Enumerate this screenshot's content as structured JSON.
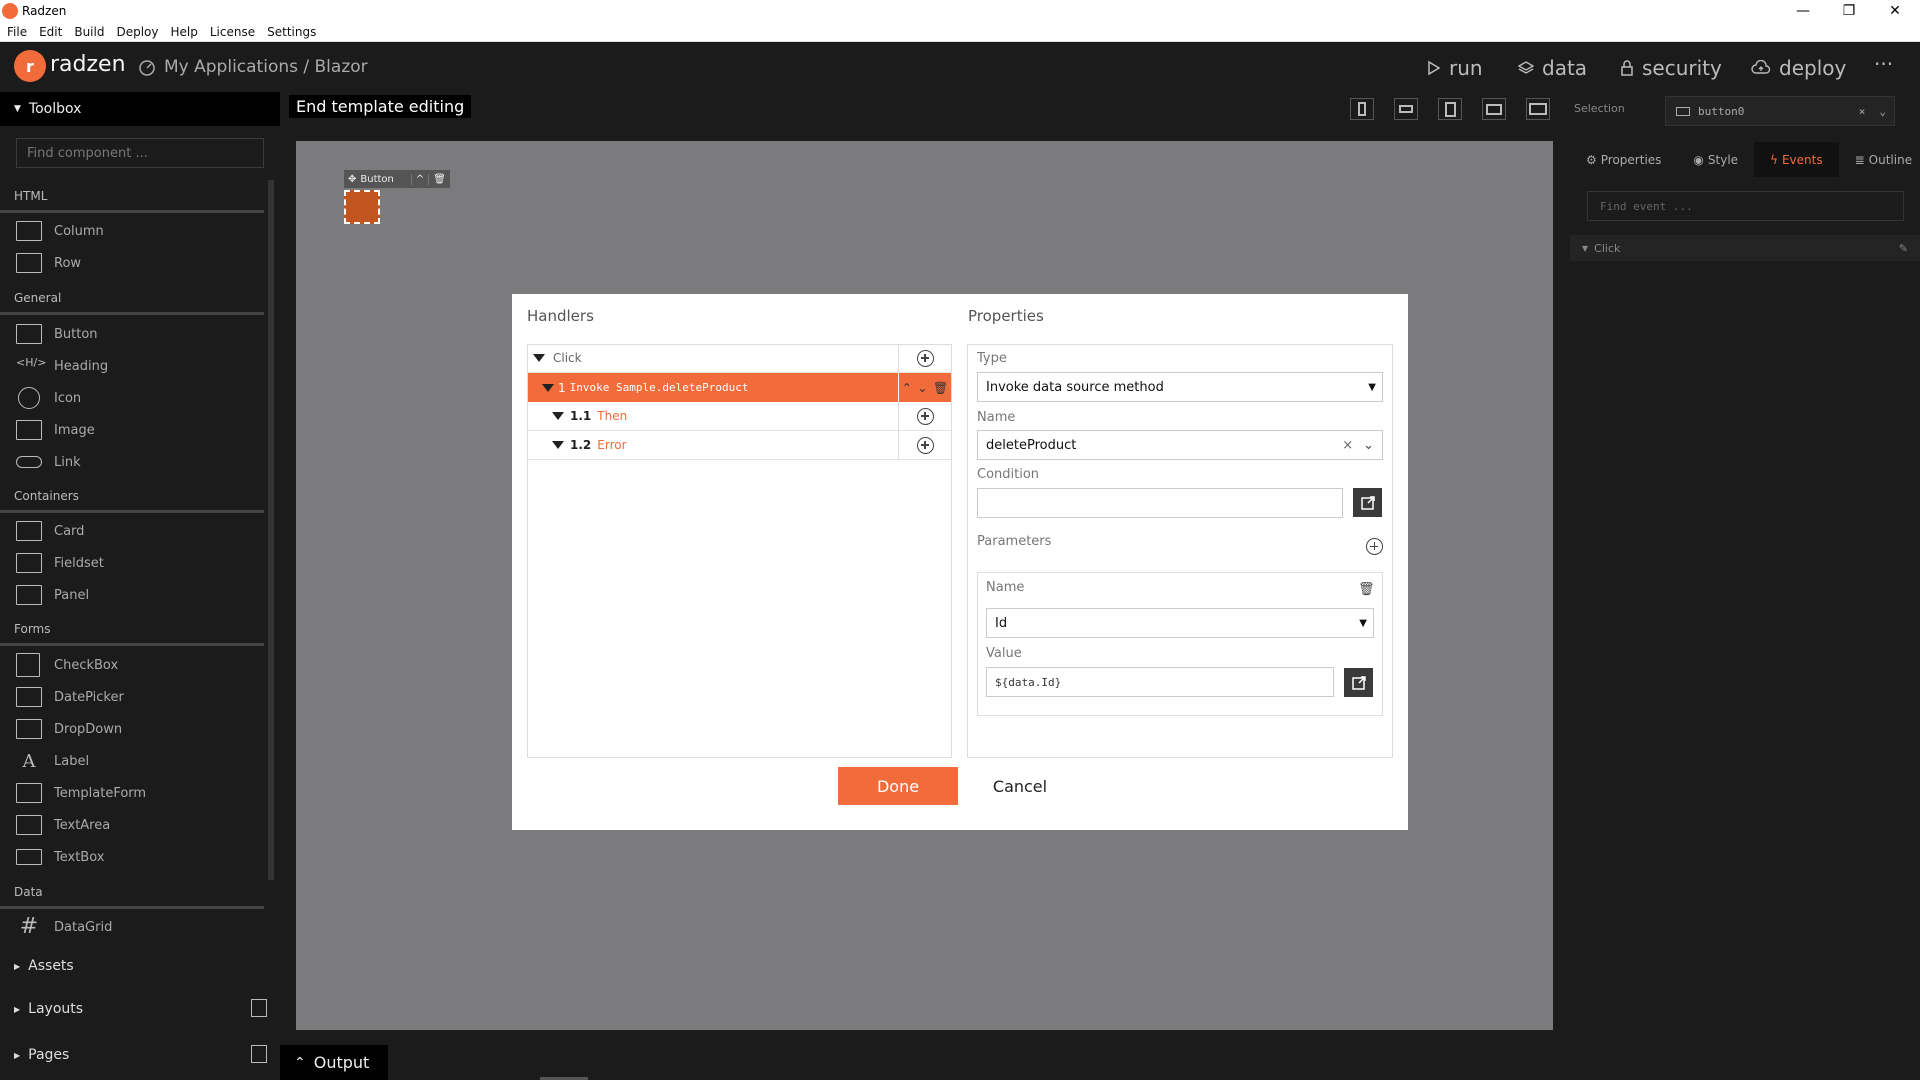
{
  "window": {
    "title": "Radzen",
    "minimize": "—",
    "restore": "❐",
    "close": "✕"
  },
  "menu": [
    "File",
    "Edit",
    "Build",
    "Deploy",
    "Help",
    "License",
    "Settings"
  ],
  "brand": {
    "logo": "r",
    "name": "radzen"
  },
  "breadcrumb": "My Applications / Blazor",
  "nav": {
    "run": "run",
    "data": "data",
    "security": "security",
    "deploy": "deploy",
    "more": "···"
  },
  "toolbox": {
    "title": "Toolbox",
    "find_placeholder": "Find component ...",
    "categories": [
      {
        "name": "HTML",
        "items": [
          "Column",
          "Row"
        ]
      },
      {
        "name": "General",
        "items": [
          "Button",
          "Heading",
          "Icon",
          "Image",
          "Link"
        ]
      },
      {
        "name": "Containers",
        "items": [
          "Card",
          "Fieldset",
          "Panel"
        ]
      },
      {
        "name": "Forms",
        "items": [
          "CheckBox",
          "DatePicker",
          "DropDown",
          "Label",
          "TemplateForm",
          "TextArea",
          "TextBox"
        ]
      },
      {
        "name": "Data",
        "items": [
          "DataGrid"
        ]
      }
    ],
    "sections": [
      "Assets",
      "Layouts",
      "Pages"
    ]
  },
  "canvas": {
    "end_template": "End template editing",
    "selected_component": "Button"
  },
  "right_panel": {
    "selection_label": "Selection",
    "selection_value": "button0",
    "tabs": [
      "Properties",
      "Style",
      "Events",
      "Outline"
    ],
    "active_tab": "Events",
    "find_event_placeholder": "Find event ...",
    "event": "Click"
  },
  "dialog": {
    "handlers_title": "Handlers",
    "properties_title": "Properties",
    "rows": {
      "click": "Click",
      "step1_num": "1",
      "step1_label": "Invoke Sample.deleteProduct",
      "then_num": "1.1",
      "then_label": "Then",
      "error_num": "1.2",
      "error_label": "Error"
    },
    "type_label": "Type",
    "type_value": "Invoke data source method",
    "name_label": "Name",
    "name_value": "deleteProduct",
    "condition_label": "Condition",
    "condition_value": "",
    "parameters_label": "Parameters",
    "param_name_label": "Name",
    "param_name_value": "Id",
    "param_value_label": "Value",
    "param_value": "${data.Id}",
    "done": "Done",
    "cancel": "Cancel"
  },
  "output": "Output",
  "colors": {
    "accent": "#f26b3a",
    "dark": "#1c1b1b",
    "canvas": "#7b7b7e"
  }
}
